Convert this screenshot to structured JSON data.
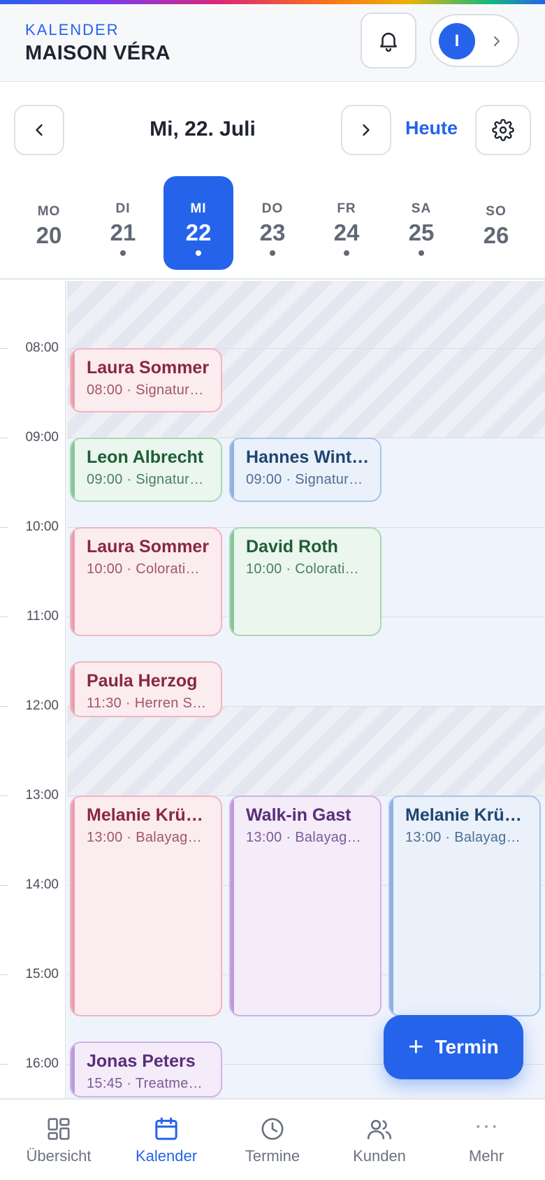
{
  "header": {
    "section_label": "KALENDER",
    "salon_name": "MAISON VÉRA",
    "avatar_initial": "I"
  },
  "datebar": {
    "current_date": "Mi, 22. Juli",
    "today_label": "Heute"
  },
  "week": [
    {
      "name": "MO",
      "num": "20",
      "has_events": false,
      "active": false
    },
    {
      "name": "DI",
      "num": "21",
      "has_events": true,
      "active": false
    },
    {
      "name": "MI",
      "num": "22",
      "has_events": true,
      "active": true
    },
    {
      "name": "DO",
      "num": "23",
      "has_events": true,
      "active": false
    },
    {
      "name": "FR",
      "num": "24",
      "has_events": true,
      "active": false
    },
    {
      "name": "SA",
      "num": "25",
      "has_events": true,
      "active": false
    },
    {
      "name": "SO",
      "num": "26",
      "has_events": false,
      "active": false
    }
  ],
  "hours": [
    "08:00",
    "09:00",
    "10:00",
    "11:00",
    "12:00",
    "13:00",
    "14:00",
    "15:00",
    "16:00"
  ],
  "appointments": [
    {
      "name": "Laura Sommer",
      "detail": "08:00 · Signatur…",
      "color": "pink"
    },
    {
      "name": "Leon Albrecht",
      "detail": "09:00 · Signatur…",
      "color": "green"
    },
    {
      "name": "Hannes Wint…",
      "detail": "09:00 · Signatur…",
      "color": "blue"
    },
    {
      "name": "Laura Sommer",
      "detail": "10:00 · Colorati…",
      "color": "pink"
    },
    {
      "name": "David Roth",
      "detail": "10:00 · Colorati…",
      "color": "green"
    },
    {
      "name": "Paula Herzog",
      "detail": "11:30 · Herren S…",
      "color": "pink"
    },
    {
      "name": "Melanie Krüg…",
      "detail": "13:00 · Balayag…",
      "color": "pink"
    },
    {
      "name": "Walk-in Gast",
      "detail": "13:00 · Balayag…",
      "color": "purple"
    },
    {
      "name": "Melanie Krüg…",
      "detail": "13:00 · Balayag…",
      "color": "blue"
    },
    {
      "name": "Jonas Peters",
      "detail": "15:45 · Treatme…",
      "color": "purple"
    }
  ],
  "fab": {
    "label": "Termin"
  },
  "bottom_nav": [
    {
      "label": "Übersicht",
      "icon": "grid-icon",
      "active": false
    },
    {
      "label": "Kalender",
      "icon": "calendar-icon",
      "active": true
    },
    {
      "label": "Termine",
      "icon": "clock-icon",
      "active": false
    },
    {
      "label": "Kunden",
      "icon": "users-icon",
      "active": false
    },
    {
      "label": "Mehr",
      "icon": "more-icon",
      "active": false
    }
  ],
  "colors": {
    "accent": "#2563eb",
    "event_pink": "#fbecef",
    "event_green": "#eaf6ee",
    "event_blue": "#eaf1fb",
    "event_purple": "#f4ecf9"
  }
}
